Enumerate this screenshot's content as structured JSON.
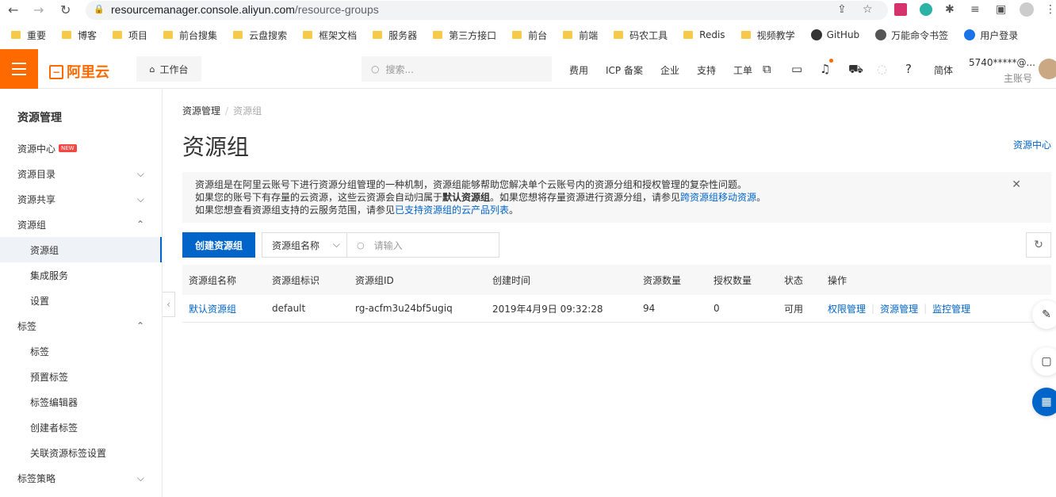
{
  "browser": {
    "url_host": "resourcemanager.console.aliyun.com",
    "url_path": "/resource-groups",
    "bookmarks": [
      "重要",
      "博客",
      "项目",
      "前台搜集",
      "云盘搜索",
      "框架文档",
      "服务器",
      "第三方接口",
      "前台",
      "前端",
      "码农工具",
      "Redis",
      "视频教学",
      "GitHub",
      "万能命令书签",
      "用户登录"
    ]
  },
  "topbar": {
    "logo": "阿里云",
    "workbench": "工作台",
    "search_placeholder": "搜索...",
    "links": [
      "费用",
      "ICP 备案",
      "企业",
      "支持",
      "工单"
    ],
    "lang": "简体",
    "account": "5740*****@...",
    "account_type": "主账号"
  },
  "sidebar": {
    "title": "资源管理",
    "items": [
      {
        "label": "资源中心",
        "badge": "NEW"
      },
      {
        "label": "资源目录"
      },
      {
        "label": "资源共享"
      },
      {
        "label": "资源组"
      },
      {
        "label": "资源组"
      },
      {
        "label": "集成服务"
      },
      {
        "label": "设置"
      },
      {
        "label": "标签"
      },
      {
        "label": "标签"
      },
      {
        "label": "预置标签"
      },
      {
        "label": "标签编辑器"
      },
      {
        "label": "创建者标签"
      },
      {
        "label": "关联资源标签设置"
      },
      {
        "label": "标签策略"
      }
    ]
  },
  "breadcrumb": {
    "root": "资源管理",
    "current": "资源组"
  },
  "page": {
    "title": "资源组",
    "right_link": "资源中心"
  },
  "info": {
    "line1": "资源组是在阿里云账号下进行资源分组管理的一种机制，资源组能够帮助您解决单个云账号内的资源分组和授权管理的复杂性问题。",
    "line2_a": "如果您的账号下有存量的云资源，这些云资源会自动归属于",
    "line2_b": "默认资源组",
    "line2_c": "。如果您想将存量资源进行资源分组，请参见",
    "line2_link": "跨资源组移动资源",
    "line2_d": "。",
    "line3_a": "如果您想查看资源组支持的云服务范围，请参见",
    "line3_link": "已支持资源组的云产品列表",
    "line3_b": "。"
  },
  "toolbar": {
    "create_label": "创建资源组",
    "select_value": "资源组名称",
    "search_placeholder": "请输入"
  },
  "table": {
    "headers": [
      "资源组名称",
      "资源组标识",
      "资源组ID",
      "创建时间",
      "资源数量",
      "授权数量",
      "状态",
      "操作"
    ],
    "rows": [
      {
        "name": "默认资源组",
        "identifier": "default",
        "id": "rg-acfm3u24bf5ugiq",
        "created": "2019年4月9日 09:32:28",
        "resources": "94",
        "grants": "0",
        "status": "可用",
        "ops": [
          "权限管理",
          "资源管理",
          "监控管理"
        ]
      }
    ]
  }
}
